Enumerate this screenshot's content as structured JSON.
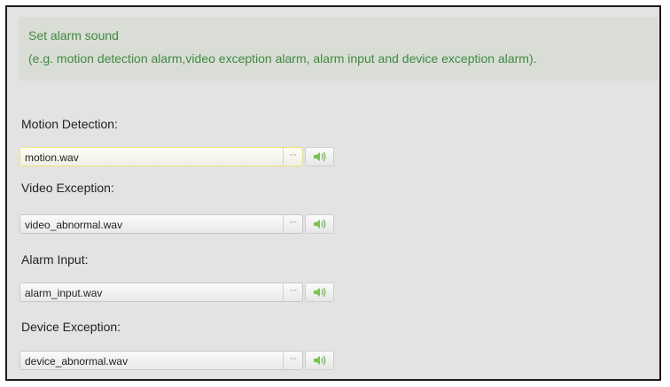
{
  "info": {
    "title": "Set alarm sound",
    "description": "(e.g. motion detection alarm,video exception alarm, alarm input and device exception alarm)."
  },
  "fields": [
    {
      "label": "Motion Detection:",
      "value": "motion.wav",
      "browse": "···"
    },
    {
      "label": "Video Exception:",
      "value": "video_abnormal.wav",
      "browse": "···"
    },
    {
      "label": "Alarm Input:",
      "value": "alarm_input.wav",
      "browse": "···"
    },
    {
      "label": "Device Exception:",
      "value": "device_abnormal.wav",
      "browse": "···"
    }
  ],
  "icons": {
    "play": "speaker-icon",
    "accent": "#7fbf5a"
  }
}
